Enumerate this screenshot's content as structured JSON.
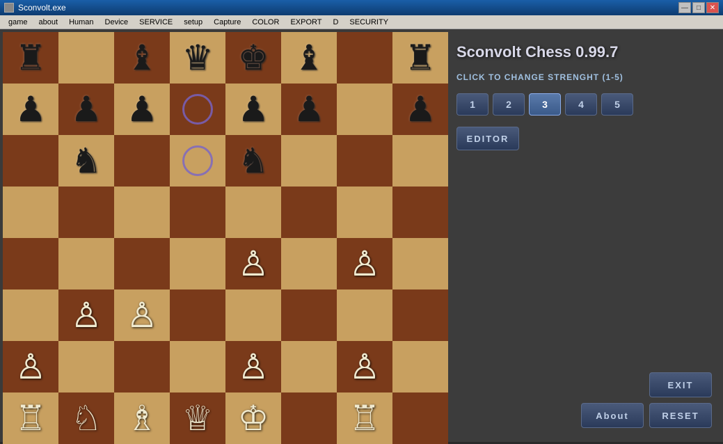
{
  "titleBar": {
    "title": "Sconvolt.exe",
    "controls": [
      "—",
      "□",
      "✕"
    ]
  },
  "menuBar": {
    "items": [
      "game",
      "about",
      "Human",
      "Device",
      "SERVICE",
      "setup",
      "Capture",
      "COLOR",
      "EXPORT",
      "D",
      "SECURITY"
    ]
  },
  "rightPanel": {
    "gameTitle": "Sconvolt Chess 0.99.7",
    "strengthLabel": "CLICK TO CHANGE STRENGHT (1-5)",
    "strengthButtons": [
      "1",
      "2",
      "3",
      "4",
      "5"
    ],
    "activeStrength": 2,
    "editorLabel": "EDITOR",
    "exitLabel": "EXIT",
    "aboutLabel": "About",
    "resetLabel": "RESET"
  },
  "board": {
    "rows": 8,
    "cols": 8,
    "pieces": [
      {
        "row": 0,
        "col": 0,
        "type": "♜",
        "color": "black"
      },
      {
        "row": 0,
        "col": 2,
        "type": "♝",
        "color": "black"
      },
      {
        "row": 0,
        "col": 3,
        "type": "♛",
        "color": "black"
      },
      {
        "row": 0,
        "col": 4,
        "type": "♚",
        "color": "black"
      },
      {
        "row": 0,
        "col": 5,
        "type": "♝",
        "color": "black"
      },
      {
        "row": 0,
        "col": 7,
        "type": "♜",
        "color": "black"
      },
      {
        "row": 1,
        "col": 0,
        "type": "♟",
        "color": "black"
      },
      {
        "row": 1,
        "col": 1,
        "type": "♟",
        "color": "black"
      },
      {
        "row": 1,
        "col": 2,
        "type": "♟",
        "color": "black"
      },
      {
        "row": 1,
        "col": 4,
        "type": "♟",
        "color": "black"
      },
      {
        "row": 1,
        "col": 5,
        "type": "♟",
        "color": "black"
      },
      {
        "row": 1,
        "col": 7,
        "type": "♟",
        "color": "black"
      },
      {
        "row": 2,
        "col": 1,
        "type": "♞",
        "color": "black"
      },
      {
        "row": 2,
        "col": 4,
        "type": "♞",
        "color": "black"
      },
      {
        "row": 4,
        "col": 4,
        "type": "♙",
        "color": "white"
      },
      {
        "row": 4,
        "col": 6,
        "type": "♙",
        "color": "white"
      },
      {
        "row": 5,
        "col": 1,
        "type": "♙",
        "color": "white"
      },
      {
        "row": 5,
        "col": 2,
        "type": "♙",
        "color": "white"
      },
      {
        "row": 6,
        "col": 0,
        "type": "♙",
        "color": "white"
      },
      {
        "row": 6,
        "col": 4,
        "type": "♙",
        "color": "white"
      },
      {
        "row": 6,
        "col": 6,
        "type": "♙",
        "color": "white"
      },
      {
        "row": 7,
        "col": 0,
        "type": "♖",
        "color": "white"
      },
      {
        "row": 7,
        "col": 1,
        "type": "♘",
        "color": "white"
      },
      {
        "row": 7,
        "col": 2,
        "type": "♗",
        "color": "white"
      },
      {
        "row": 7,
        "col": 3,
        "type": "♕",
        "color": "white"
      },
      {
        "row": 7,
        "col": 4,
        "type": "♔",
        "color": "white"
      },
      {
        "row": 7,
        "col": 6,
        "type": "♖",
        "color": "white"
      }
    ],
    "circles": [
      {
        "row": 1,
        "col": 3
      },
      {
        "row": 2,
        "col": 3
      }
    ]
  }
}
